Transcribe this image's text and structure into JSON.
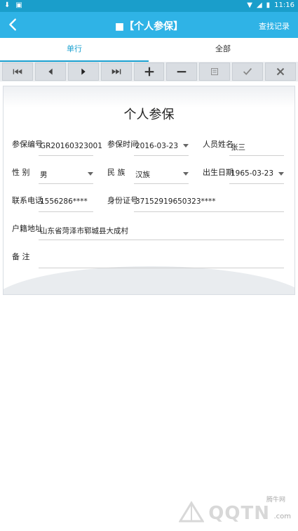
{
  "status": {
    "time": "11:16"
  },
  "appbar": {
    "title": "■【个人参保】",
    "action": "查找记录"
  },
  "tabs": [
    {
      "label": "单行"
    },
    {
      "label": "全部"
    }
  ],
  "toolbar_buttons": [
    "first-icon",
    "prev-icon",
    "next-icon",
    "last-icon",
    "add-icon",
    "remove-icon",
    "edit-icon",
    "check-icon",
    "close-icon"
  ],
  "form": {
    "title": "个人参保",
    "fields": {
      "insurance_no": {
        "label": "参保编号",
        "value": "GR20160323001"
      },
      "insured_date": {
        "label": "参保时间",
        "value": "2016-03-23"
      },
      "name": {
        "label": "人员姓名",
        "value": "张三"
      },
      "gender": {
        "label": "性 别",
        "value": "男"
      },
      "ethnicity": {
        "label": "民 族",
        "value": "汉族"
      },
      "birth_date": {
        "label": "出生日期",
        "value": "1965-03-23"
      },
      "phone": {
        "label": "联系电话",
        "value": "1556286****"
      },
      "id_no": {
        "label": "身份证号",
        "value": "37152919650323****"
      },
      "address": {
        "label": "户籍地址",
        "value": "山东省菏泽市郓城县大成村"
      },
      "remark": {
        "label": "备 注",
        "value": ""
      }
    }
  },
  "watermark": {
    "small": "腾牛网",
    "big": "QQTN",
    "com": ".com"
  }
}
